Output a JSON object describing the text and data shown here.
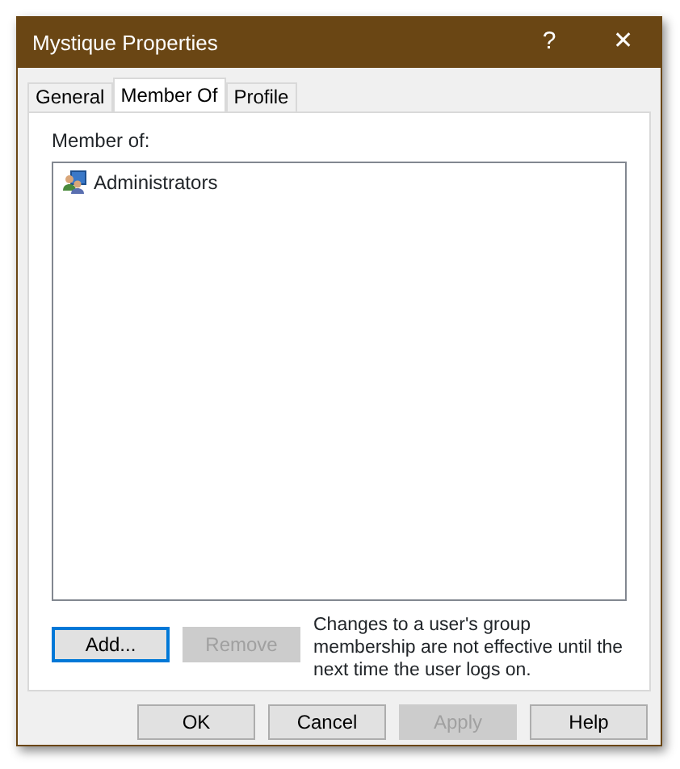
{
  "window": {
    "title": "Mystique Properties",
    "help": "?",
    "close": "✕"
  },
  "tabs": [
    {
      "label": "General",
      "selected": false
    },
    {
      "label": "Member Of",
      "selected": true
    },
    {
      "label": "Profile",
      "selected": false
    }
  ],
  "member_of": {
    "label": "Member of:",
    "items": [
      {
        "name": "Administrators",
        "selected": false
      }
    ]
  },
  "list_buttons": [
    {
      "label": "Add...",
      "disabled": false,
      "focused": true
    },
    {
      "label": "Remove",
      "disabled": true,
      "focused": false
    }
  ],
  "note": "Changes to a user's group membership are not effective until the next time the user logs on.",
  "buttons": [
    {
      "label": "OK",
      "disabled": false
    },
    {
      "label": "Cancel",
      "disabled": false
    },
    {
      "label": "Apply",
      "disabled": true
    },
    {
      "label": "Help",
      "disabled": false
    }
  ]
}
